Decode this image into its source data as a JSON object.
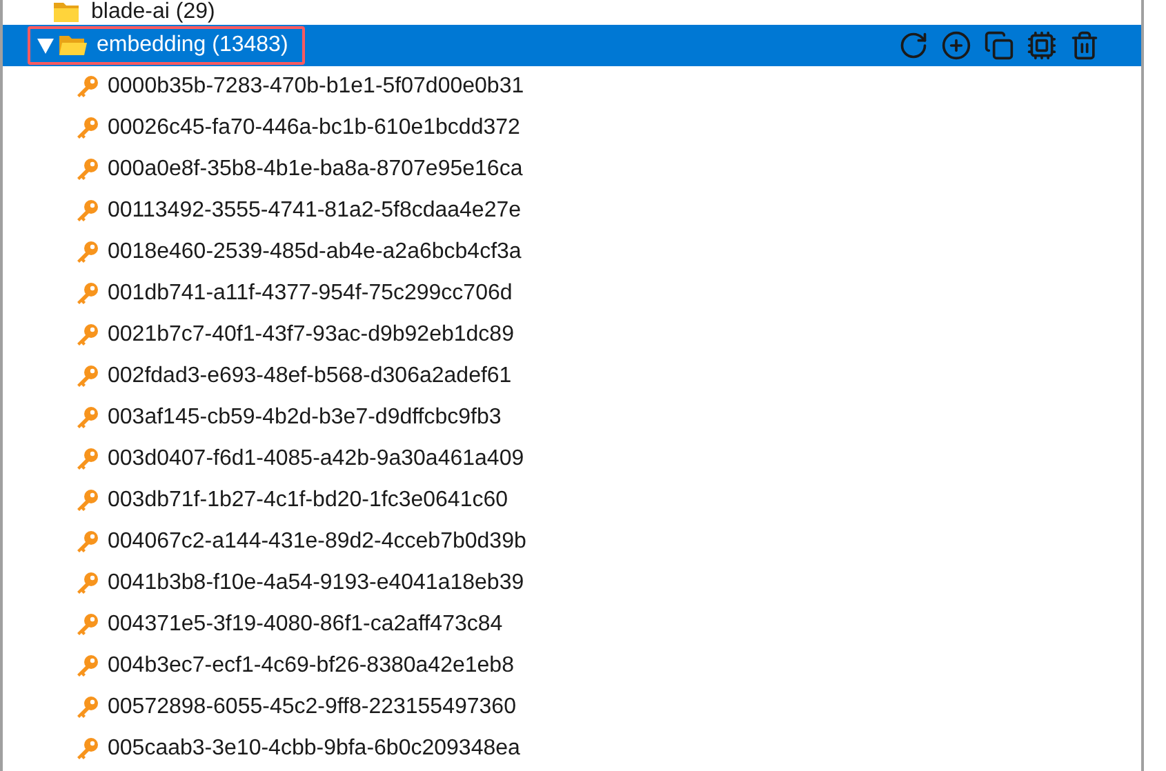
{
  "tree": {
    "parent": {
      "label": "blade-ai (29)",
      "expanded": false
    },
    "folder": {
      "label": "embedding (13483)",
      "expanded": true,
      "selected": true,
      "highlighted": true
    },
    "actions": [
      {
        "kind": "refresh"
      },
      {
        "kind": "add"
      },
      {
        "kind": "copy"
      },
      {
        "kind": "chip"
      },
      {
        "kind": "delete"
      }
    ],
    "keys": [
      {
        "label": "0000b35b-7283-470b-b1e1-5f07d00e0b31"
      },
      {
        "label": "00026c45-fa70-446a-bc1b-610e1bcdd372"
      },
      {
        "label": "000a0e8f-35b8-4b1e-ba8a-8707e95e16ca"
      },
      {
        "label": "00113492-3555-4741-81a2-5f8cdaa4e27e"
      },
      {
        "label": "0018e460-2539-485d-ab4e-a2a6bcb4cf3a"
      },
      {
        "label": "001db741-a11f-4377-954f-75c299cc706d"
      },
      {
        "label": "0021b7c7-40f1-43f7-93ac-d9b92eb1dc89"
      },
      {
        "label": "002fdad3-e693-48ef-b568-d306a2adef61"
      },
      {
        "label": "003af145-cb59-4b2d-b3e7-d9dffcbc9fb3"
      },
      {
        "label": "003d0407-f6d1-4085-a42b-9a30a461a409"
      },
      {
        "label": "003db71f-1b27-4c1f-bd20-1fc3e0641c60"
      },
      {
        "label": "004067c2-a144-431e-89d2-4cceb7b0d39b"
      },
      {
        "label": "0041b3b8-f10e-4a54-9193-e4041a18eb39"
      },
      {
        "label": "004371e5-3f19-4080-86f1-ca2aff473c84"
      },
      {
        "label": "004b3ec7-ecf1-4c69-bf26-8380a42e1eb8"
      },
      {
        "label": "00572898-6055-45c2-9ff8-223155497360"
      },
      {
        "label": "005caab3-3e10-4cbb-9bfa-6b0c209348ea"
      }
    ]
  }
}
